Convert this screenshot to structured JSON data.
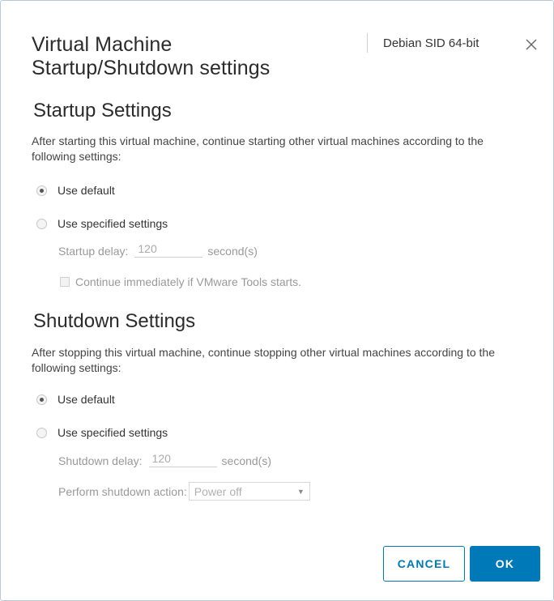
{
  "dialog": {
    "title_line1": "Virtual Machine",
    "title_line2": "Startup/Shutdown settings",
    "vm_name": "Debian SID 64-bit"
  },
  "startup": {
    "heading": "Startup Settings",
    "description": "After starting this virtual machine, continue starting other virtual machines according to the following settings:",
    "option_default": "Use default",
    "option_specified": "Use specified settings",
    "selected": "default",
    "delay_label": "Startup delay:",
    "delay_value": "120",
    "delay_unit": "second(s)",
    "tools_checkbox_label": "Continue immediately if VMware Tools starts.",
    "tools_checked": false
  },
  "shutdown": {
    "heading": "Shutdown Settings",
    "description": "After stopping this virtual machine, continue stopping other virtual machines according to the following settings:",
    "option_default": "Use default",
    "option_specified": "Use specified settings",
    "selected": "default",
    "delay_label": "Shutdown delay:",
    "delay_value": "120",
    "delay_unit": "second(s)",
    "action_label": "Perform shutdown action:",
    "action_value": "Power off"
  },
  "footer": {
    "cancel_label": "CANCEL",
    "ok_label": "OK"
  },
  "colors": {
    "accent": "#0079b8",
    "border": "#b7c9d9"
  },
  "icons": {
    "close": "close-icon",
    "dropdown": "chevron-down-icon"
  }
}
